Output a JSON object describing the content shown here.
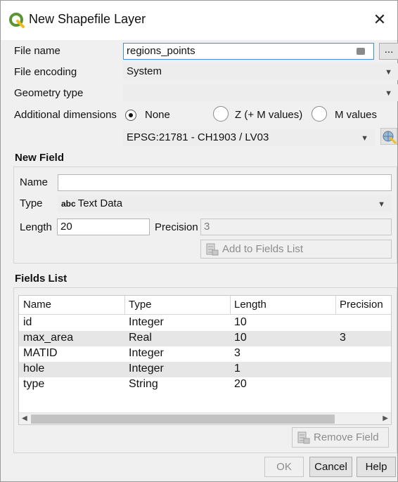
{
  "window": {
    "title": "New Shapefile Layer",
    "close_glyph": "✕"
  },
  "form": {
    "file_name_label": "File name",
    "file_name_value": "regions_points",
    "browse_label": "...",
    "file_encoding_label": "File encoding",
    "file_encoding_value": "System",
    "geometry_type_label": "Geometry type",
    "geometry_type_value": "",
    "additional_dimensions_label": "Additional dimensions",
    "dim_none": "None",
    "dim_z": "Z (+ M values)",
    "dim_m": "M values",
    "crs_value": "EPSG:21781 - CH1903 / LV03"
  },
  "new_field": {
    "section_title": "New Field",
    "name_label": "Name",
    "name_value": "",
    "type_label": "Type",
    "type_icon_text": "abc",
    "type_value": "Text Data",
    "length_label": "Length",
    "length_value": "20",
    "precision_label": "Precision",
    "precision_value": "3",
    "add_button": "Add to Fields List"
  },
  "fields_list": {
    "section_title": "Fields List",
    "columns": [
      "Name",
      "Type",
      "Length",
      "Precision"
    ],
    "rows": [
      [
        "id",
        "Integer",
        "10",
        ""
      ],
      [
        "max_area",
        "Real",
        "10",
        "3"
      ],
      [
        "MATID",
        "Integer",
        "3",
        ""
      ],
      [
        "hole",
        "Integer",
        "1",
        ""
      ],
      [
        "type",
        "String",
        "20",
        ""
      ]
    ],
    "remove_button": "Remove Field"
  },
  "buttons": {
    "ok": "OK",
    "cancel": "Cancel",
    "help": "Help"
  },
  "colors": {
    "qgis_green": "#589632",
    "qgis_yellow": "#eebd1a",
    "focus_border": "#3a8ee6"
  }
}
